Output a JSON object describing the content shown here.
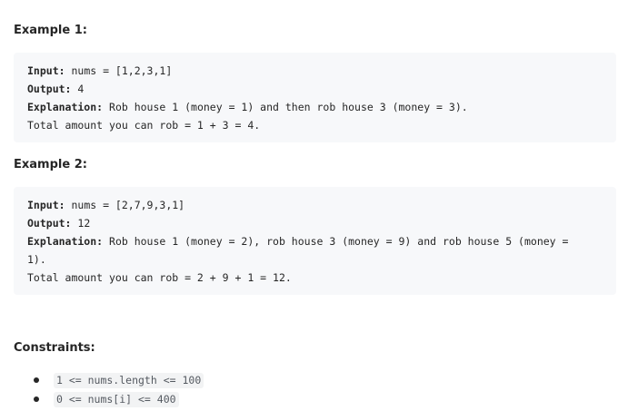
{
  "example1": {
    "heading": "Example 1:",
    "input_label": "Input:",
    "input_value": " nums = [1,2,3,1]",
    "output_label": "Output:",
    "output_value": " 4",
    "explanation_label": "Explanation:",
    "explanation_text": " Rob house 1 (money = 1) and then rob house 3 (money = 3).",
    "explanation_line2": "Total amount you can rob = 1 + 3 = 4."
  },
  "example2": {
    "heading": "Example 2:",
    "input_label": "Input:",
    "input_value": " nums = [2,7,9,3,1]",
    "output_label": "Output:",
    "output_value": " 12",
    "explanation_label": "Explanation:",
    "explanation_text": " Rob house 1 (money = 2), rob house 3 (money = 9) and rob house 5 (money =",
    "explanation_wrap": "1).",
    "explanation_line2": "Total amount you can rob = 2 + 9 + 1 = 12."
  },
  "constraints": {
    "heading": "Constraints:",
    "items": [
      "1 <= nums.length <= 100",
      "0 <= nums[i] <= 400"
    ]
  }
}
